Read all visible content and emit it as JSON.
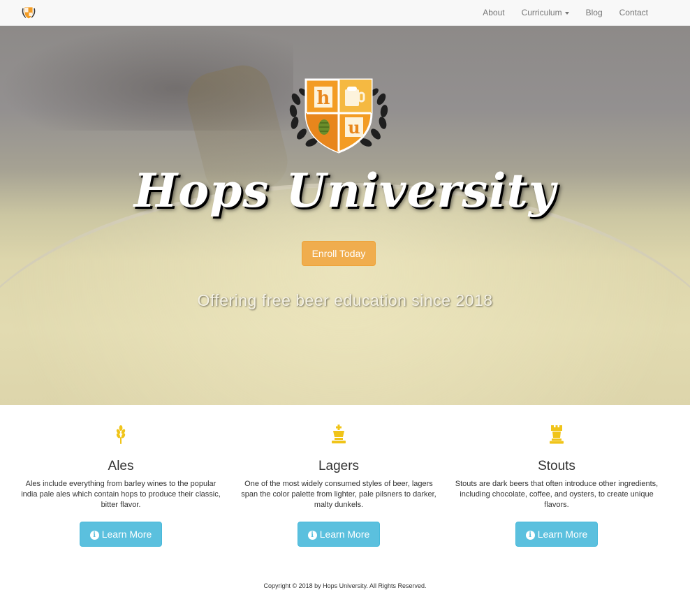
{
  "navbar": {
    "brand_icon": "hops-university-crest-icon",
    "links": [
      {
        "label": "About"
      },
      {
        "label": "Curriculum",
        "has_dropdown": true
      },
      {
        "label": "Blog"
      },
      {
        "label": "Contact"
      }
    ]
  },
  "hero": {
    "crest_letters": [
      "h",
      "u"
    ],
    "title": "Hops University",
    "enroll_label": "Enroll Today",
    "tagline": "Offering free beer education since 2018"
  },
  "features": [
    {
      "icon": "wheat-icon",
      "title": "Ales",
      "text": "Ales include everything from barley wines to the popular india pale ales which contain hops to produce their classic, bitter flavor.",
      "button": "Learn More"
    },
    {
      "icon": "king-chess-icon",
      "title": "Lagers",
      "text": "One of the most widely consumed styles of beer, lagers span the color palette from lighter, pale pilsners to darker, malty dunkels.",
      "button": "Learn More"
    },
    {
      "icon": "rook-chess-icon",
      "title": "Stouts",
      "text": "Stouts are dark beers that often introduce other ingredients, including chocolate, coffee, and oysters, to create unique flavors.",
      "button": "Learn More"
    }
  ],
  "footer": {
    "copyright": "Copyright © 2018 by Hops University. All Rights Reserved."
  },
  "colors": {
    "accent_orange": "#f0ad4e",
    "info_blue": "#5bc0de",
    "icon_gold": "#f0c419",
    "crest_orange": "#f39c24"
  }
}
